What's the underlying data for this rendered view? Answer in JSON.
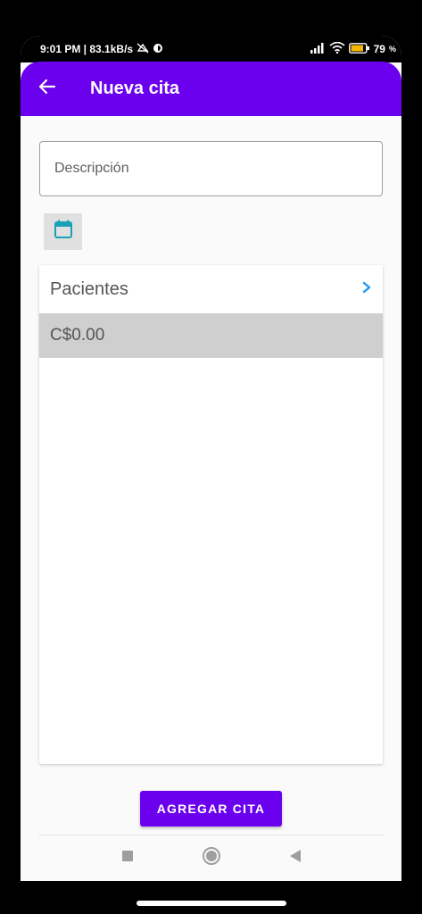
{
  "status_bar": {
    "time_speed": "9:01 PM | 83.1kB/s",
    "battery": "79",
    "battery_unit": "%"
  },
  "app_bar": {
    "title": "Nueva cita"
  },
  "form": {
    "description_placeholder": "Descripción",
    "description_value": "",
    "patients_label": "Pacientes",
    "price": "C$0.00"
  },
  "actions": {
    "add_label": "AGREGAR CITA"
  },
  "colors": {
    "primary": "#6a00ee",
    "calendar_icon": "#1aa1b7",
    "chevron": "#2196f3"
  }
}
